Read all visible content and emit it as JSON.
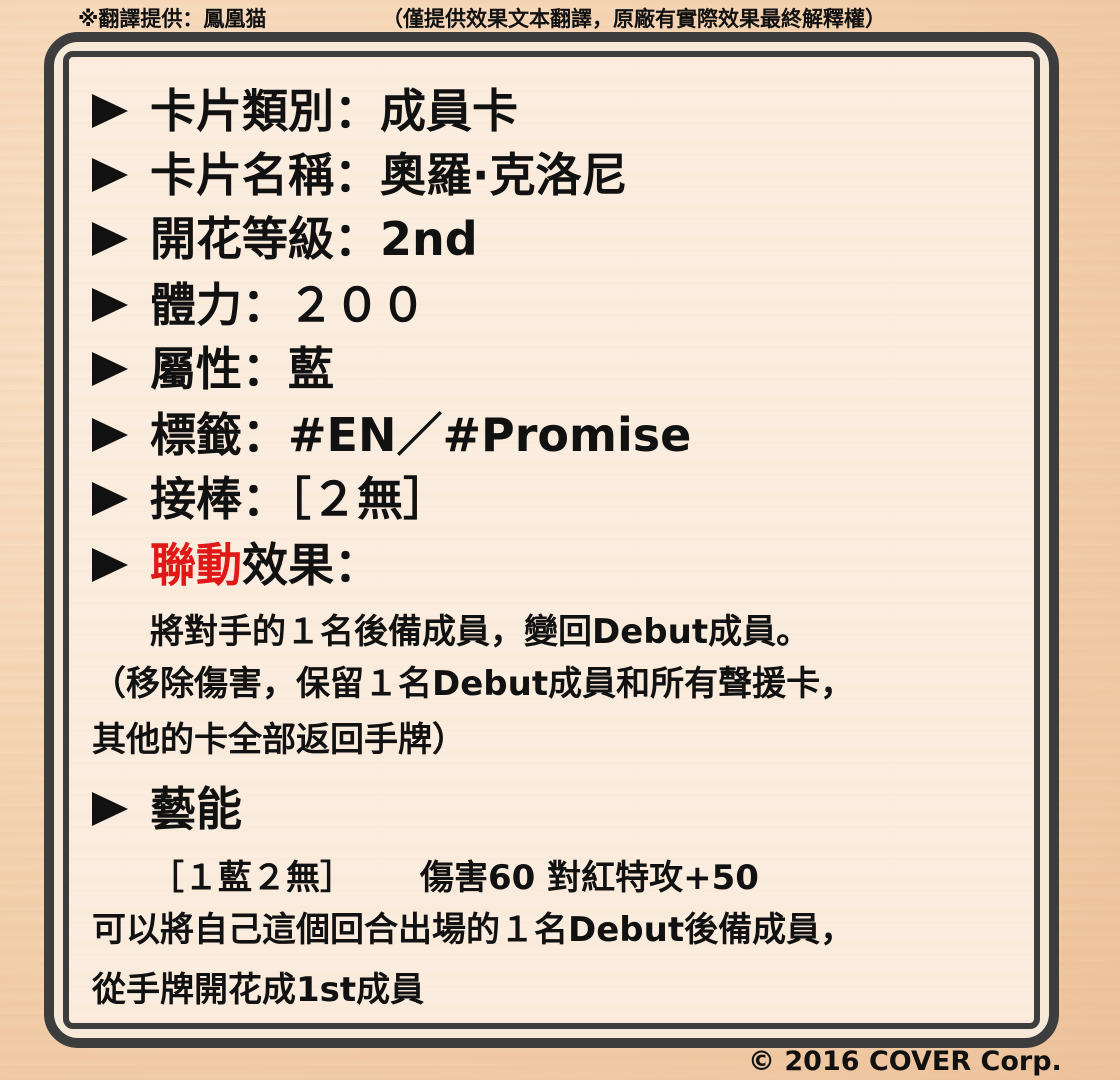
{
  "header": {
    "credit": "※翻譯提供：鳳凰猫",
    "disclaimer": "（僅提供效果文本翻譯，原廠有實際效果最終解釋權）"
  },
  "card": {
    "type": "卡片類別：成員卡",
    "name": "卡片名稱：奧羅·克洛尼",
    "bloom": "開花等級：2nd",
    "hp": "體力：２００",
    "color": "屬性：藍",
    "tags": "標籤：#EN／#Promise",
    "baton": "接棒：［２無］",
    "collab_highlight": "聯動",
    "collab_rest": "效果：",
    "collab_text_1": "將對手的１名後備成員，變回Debut成員。",
    "collab_text_2": "（移除傷害，保留１名Debut成員和所有聲援卡，",
    "collab_text_3": "其他的卡全部返回手牌）",
    "arts_heading": "藝能",
    "arts_cost": "［１藍２無］",
    "arts_damage": "傷害60 對紅特攻+50",
    "arts_text_1": "可以將自己這個回合出場的１名Debut後備成員，",
    "arts_text_2": "從手牌開花成1st成員"
  },
  "footer": {
    "copyright": "© 2016 COVER Corp."
  }
}
